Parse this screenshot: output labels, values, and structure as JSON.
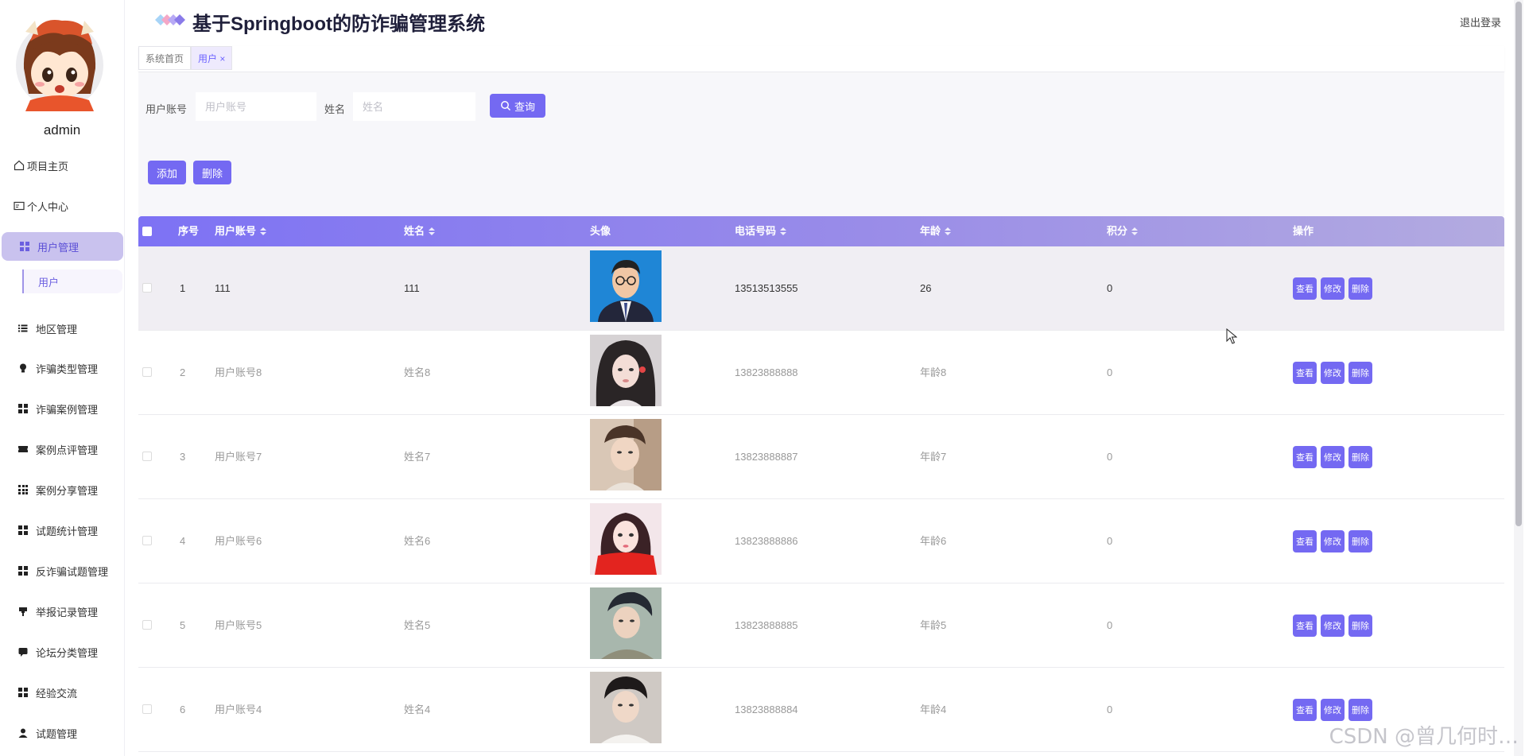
{
  "app": {
    "title": "基于Springboot的防诈骗管理系统",
    "logout": "退出登录",
    "username": "admin",
    "accent_color": "#7469f2"
  },
  "sidebar": {
    "items": [
      {
        "label": "项目主页",
        "icon": "home-icon"
      },
      {
        "label": "个人中心",
        "icon": "id-card-icon"
      },
      {
        "label": "用户管理",
        "icon": "grid-icon",
        "active": true
      },
      {
        "label": "地区管理",
        "icon": "list-icon"
      },
      {
        "label": "诈骗类型管理",
        "icon": "bulb-icon"
      },
      {
        "label": "诈骗案例管理",
        "icon": "grid-icon"
      },
      {
        "label": "案例点评管理",
        "icon": "ticket-icon"
      },
      {
        "label": "案例分享管理",
        "icon": "grid9-icon"
      },
      {
        "label": "试题统计管理",
        "icon": "grid-icon"
      },
      {
        "label": "反诈骗试题管理",
        "icon": "grid-icon"
      },
      {
        "label": "举报记录管理",
        "icon": "flag-icon"
      },
      {
        "label": "论坛分类管理",
        "icon": "chat-icon"
      },
      {
        "label": "经验交流",
        "icon": "grid-icon"
      },
      {
        "label": "试题管理",
        "icon": "person-icon"
      }
    ],
    "sub_item": "用户"
  },
  "tabs": [
    {
      "label": "系统首页"
    },
    {
      "label": "用户 ×",
      "active": true
    }
  ],
  "search": {
    "account_label": "用户账号",
    "account_placeholder": "用户账号",
    "name_label": "姓名",
    "name_placeholder": "姓名",
    "query_button": "查询"
  },
  "actions": {
    "add": "添加",
    "delete": "删除"
  },
  "table": {
    "columns": [
      "序号",
      "用户账号",
      "姓名",
      "头像",
      "电话号码",
      "年龄",
      "积分",
      "操作"
    ],
    "ops": {
      "view": "查看",
      "edit": "修改",
      "delete": "删除"
    },
    "rows": [
      {
        "index": "1",
        "account": "111",
        "name": "111",
        "phone": "13513513555",
        "age": "26",
        "points": "0"
      },
      {
        "index": "2",
        "account": "用户账号8",
        "name": "姓名8",
        "phone": "13823888888",
        "age": "年龄8",
        "points": "0"
      },
      {
        "index": "3",
        "account": "用户账号7",
        "name": "姓名7",
        "phone": "13823888887",
        "age": "年龄7",
        "points": "0"
      },
      {
        "index": "4",
        "account": "用户账号6",
        "name": "姓名6",
        "phone": "13823888886",
        "age": "年龄6",
        "points": "0"
      },
      {
        "index": "5",
        "account": "用户账号5",
        "name": "姓名5",
        "phone": "13823888885",
        "age": "年龄5",
        "points": "0"
      },
      {
        "index": "6",
        "account": "用户账号4",
        "name": "姓名4",
        "phone": "13823888884",
        "age": "年龄4",
        "points": "0"
      }
    ]
  },
  "watermark": "CSDN @曾几何时…"
}
